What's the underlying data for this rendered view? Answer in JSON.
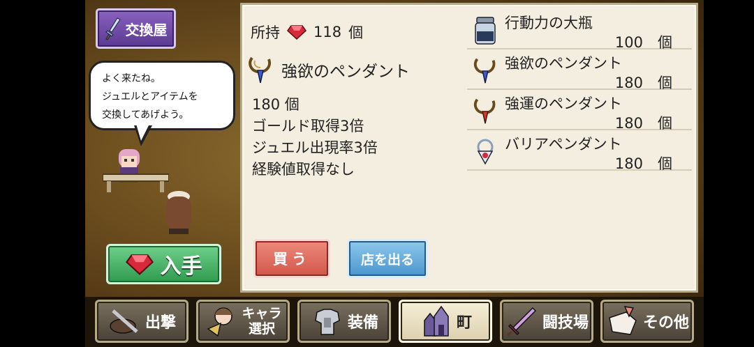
{
  "shop": {
    "tag": "交換屋"
  },
  "dialog": {
    "lines": [
      "よく来たね。",
      "ジュエルとアイテムを",
      "交換してあげよう。"
    ]
  },
  "get_button": "入手",
  "owned": {
    "label": "所持",
    "count": "118",
    "unit": "個"
  },
  "selected": {
    "name": "強欲のペンダント",
    "lines": [
      "180 個",
      "ゴールド取得3倍",
      "ジュエル出現率3倍",
      "経験値取得なし"
    ]
  },
  "items": [
    {
      "name": "行動力の大瓶",
      "count": "100",
      "unit": "個",
      "icon": "bottle-icon"
    },
    {
      "name": "強欲のペンダント",
      "count": "180",
      "unit": "個",
      "icon": "blue-pendant-icon"
    },
    {
      "name": "強運のペンダント",
      "count": "180",
      "unit": "個",
      "icon": "red-pendant-icon"
    },
    {
      "name": "バリアペンダント",
      "count": "180",
      "unit": "個",
      "icon": "barrier-pendant-icon"
    }
  ],
  "buttons": {
    "buy": "買う",
    "leave": "店を出る"
  },
  "nav": [
    {
      "label": "出撃",
      "icon": "sortie-icon"
    },
    {
      "label": "キャラ選択",
      "label_l1": "キャラ",
      "label_l2": "選択",
      "icon": "character-icon"
    },
    {
      "label": "装備",
      "icon": "armor-icon"
    },
    {
      "label": "町",
      "icon": "town-icon",
      "active": true
    },
    {
      "label": "闘技場",
      "icon": "arena-sword-icon"
    },
    {
      "label": "その他",
      "icon": "other-icon"
    }
  ],
  "colors": {
    "panel_bg": "#f3eee0",
    "buy": "#d2564a",
    "leave": "#4a95cc",
    "get": "#2f9a4e",
    "tag": "#5a3a90"
  }
}
